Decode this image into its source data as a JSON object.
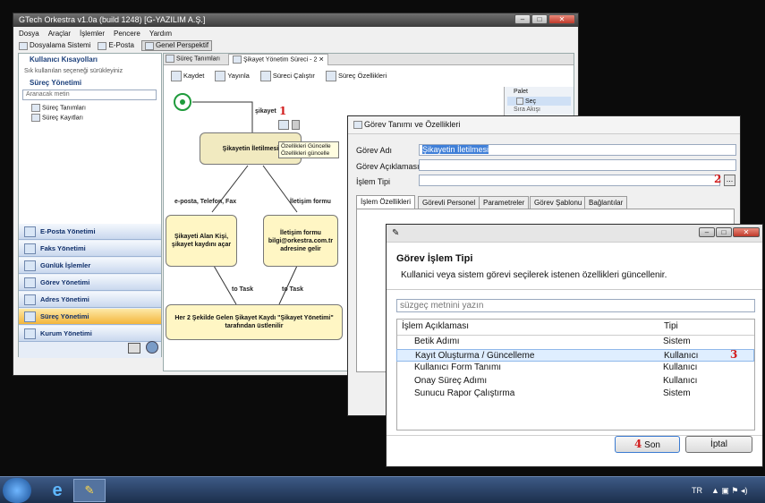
{
  "main_window": {
    "title": "GTech Orkestra v1.0a (build 1248) [G-YAZILIM A.Ş.]",
    "menu": [
      "Dosya",
      "Araçlar",
      "İşlemler",
      "Pencere",
      "Yardım"
    ],
    "toolbar": {
      "docs": "Dosyalama Sistemi",
      "email": "E-Posta",
      "perspective": "Genel Perspektif"
    },
    "sidebar": {
      "shortcuts_header": "Kullanıcı Kısayolları",
      "shortcuts_hint": "Sık kullanılan seçeneği sürükleyiniz",
      "process_header": "Süreç Yönetimi",
      "search_placeholder": "Aranacak metin",
      "tree": [
        "Süreç Tanımları",
        "Süreç Kayıtları"
      ],
      "nav": [
        "E-Posta Yönetimi",
        "Faks Yönetimi",
        "Günlük İşlemler",
        "Görev Yönetimi",
        "Adres Yönetimi",
        "Süreç Yönetimi",
        "Kurum Yönetimi"
      ],
      "active_nav": "Süreç Yönetimi"
    },
    "editor": {
      "tabs": [
        "Süreç Tanımları",
        "Şikayet Yönetim Süreci - 2"
      ],
      "toolbar": [
        "Kaydet",
        "Yayınla",
        "Süreci Çalıştır",
        "Süreç Özellikleri"
      ],
      "palette": "Palet",
      "palette_select": "Seç",
      "palette_more": "Sıra Akışı"
    },
    "diagram": {
      "label_sikayet": "şikayet",
      "step1": "1",
      "node_main": "Şikayetin İletilmesi",
      "tooltip_title": "Özellikleri Güncelle",
      "tooltip_text": "Özellikleri güncelle",
      "edge_left": "e-posta, Telefon, Fax",
      "edge_right": "İletişim formu",
      "node_left": "Şikayeti Alan Kişi, şikayet kaydını açar",
      "node_right": "İletişim formu bilgi@orkestra.com.tr adresine gelir",
      "to_task_1": "to Task",
      "to_task_2": "to Task",
      "node_bottom_1": "Her 2 Şekilde Gelen Şikayet Kaydı \"Şikayet Yönetimi\"",
      "node_bottom_2": "tarafından üstlenilir"
    }
  },
  "gorev_dialog": {
    "title": "Görev Tanımı ve Özellikleri",
    "fields": {
      "name_label": "Görev Adı",
      "name_value": "Şikayetin İletilmesi",
      "desc_label": "Görev Açıklaması",
      "type_label": "İşlem Tipi",
      "browse": "...",
      "step2": "2"
    },
    "tabs": [
      "İşlem Özellikleri",
      "Görevli Personel",
      "Parametreler",
      "Görev Şablonu",
      "Bağlantılar"
    ]
  },
  "islem_dialog": {
    "title": "Görev İşlem Tipi",
    "description": "Kullanici veya sistem görevi seçilerek istenen özellikleri güncellenir.",
    "filter_placeholder": "süzgeç metnini yazın",
    "columns": [
      "İşlem Açıklaması",
      "Tipi"
    ],
    "rows": [
      {
        "name": "Betik Adımı",
        "type": "Sistem"
      },
      {
        "name": "Kayıt Oluşturma / Güncelleme",
        "type": "Kullanıcı"
      },
      {
        "name": "Kullanıcı Form Tanımı",
        "type": "Kullanıcı"
      },
      {
        "name": "Onay Süreç Adımı",
        "type": "Kullanıcı"
      },
      {
        "name": "Sunucu Rapor Çalıştırma",
        "type": "Sistem"
      }
    ],
    "selected_index": 1,
    "step3": "3",
    "step4": "4",
    "ok_label": "Son",
    "cancel_label": "İptal"
  },
  "taskbar": {
    "lang": "TR",
    "clock": "⌚"
  }
}
